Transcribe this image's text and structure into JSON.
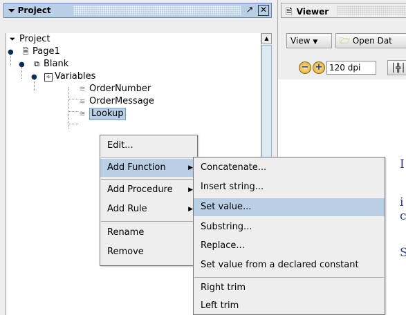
{
  "project_panel": {
    "title": "Project",
    "tree": {
      "root": "Project",
      "page": "Page1",
      "blank": "Blank",
      "variables": "Variables",
      "items": [
        "OrderNumber",
        "OrderMessage",
        "Lookup"
      ]
    }
  },
  "viewer_panel": {
    "title": "Viewer",
    "view_button": "View",
    "open_button": "Open Dat",
    "dpi_value": "120 dpi"
  },
  "context_menu": {
    "items": [
      "Edit...",
      "Add Function",
      "Add Procedure",
      "Add Rule",
      "Rename",
      "Remove"
    ]
  },
  "submenu": {
    "items": [
      "Concatenate...",
      "Insert string...",
      "Set value...",
      "Substring...",
      "Replace...",
      "Set value from a declared constant",
      "Right trim",
      "Left trim"
    ]
  },
  "canvas_text": {
    "c1": "I",
    "c2": "i",
    "c3": "c",
    "c4": "S"
  }
}
